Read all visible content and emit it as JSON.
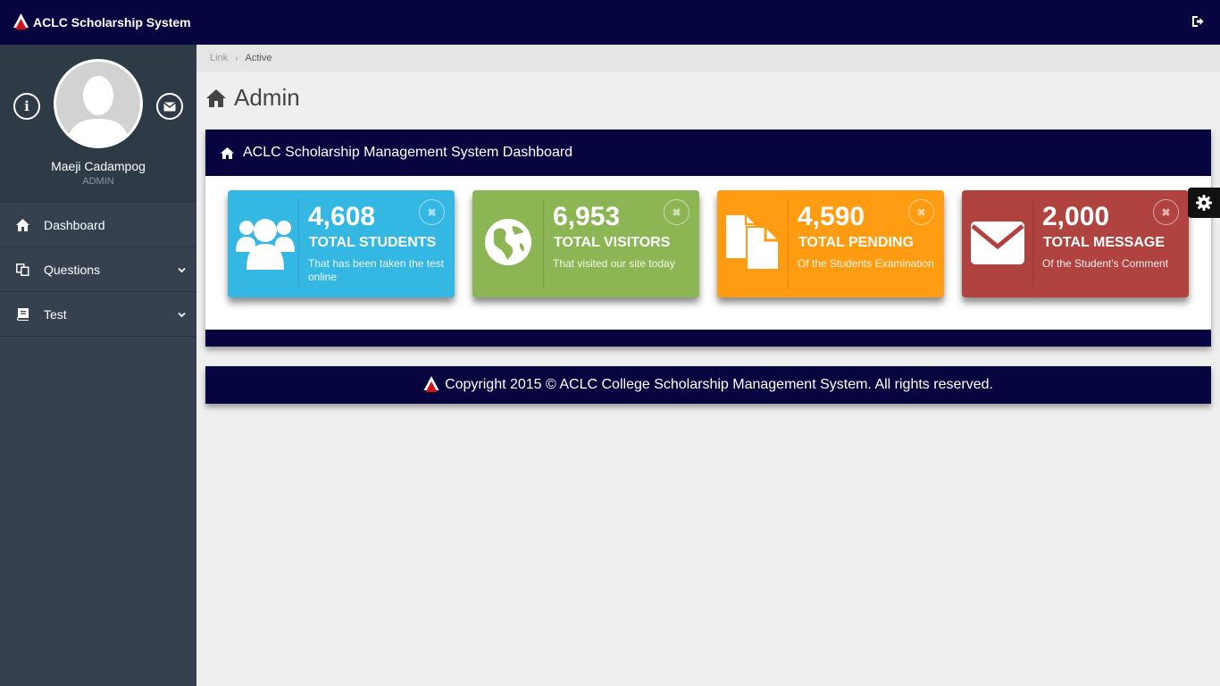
{
  "app": {
    "title": "ACLC Scholarship System"
  },
  "sidebar": {
    "user_name": "Maeji Cadampog",
    "user_role": "ADMIN",
    "info_glyph": "i",
    "items": [
      {
        "label": "Dashboard",
        "icon": "home-icon"
      },
      {
        "label": "Questions",
        "icon": "copy-icon"
      },
      {
        "label": "Test",
        "icon": "book-icon"
      }
    ]
  },
  "breadcrumb": {
    "link": "Link",
    "separator": "›",
    "active": "Active"
  },
  "page": {
    "title": "Admin"
  },
  "panel": {
    "title": "ACLC Scholarship Management System Dashboard"
  },
  "stats": [
    {
      "value": "4,608",
      "label": "TOTAL STUDENTS",
      "desc": "That has been taken the test online",
      "color": "#35b7e3",
      "icon": "users-icon"
    },
    {
      "value": "6,953",
      "label": "TOTAL VISITORS",
      "desc": "That visited our site today",
      "color": "#8cb554",
      "icon": "globe-icon"
    },
    {
      "value": "4,590",
      "label": "TOTAL PENDING",
      "desc": "Of the Students Examination",
      "color": "#ff9c11",
      "icon": "files-icon"
    },
    {
      "value": "2,000",
      "label": "TOTAL MESSAGE",
      "desc": "Of the Student's Comment",
      "color": "#b0433f",
      "icon": "envelope-icon"
    }
  ],
  "close_glyph": "✖",
  "footer": {
    "text": "Copyright 2015 © ACLC College Scholarship Management System. All rights reserved."
  },
  "colors": {
    "navy": "#06053f",
    "sidebar": "#364150"
  }
}
